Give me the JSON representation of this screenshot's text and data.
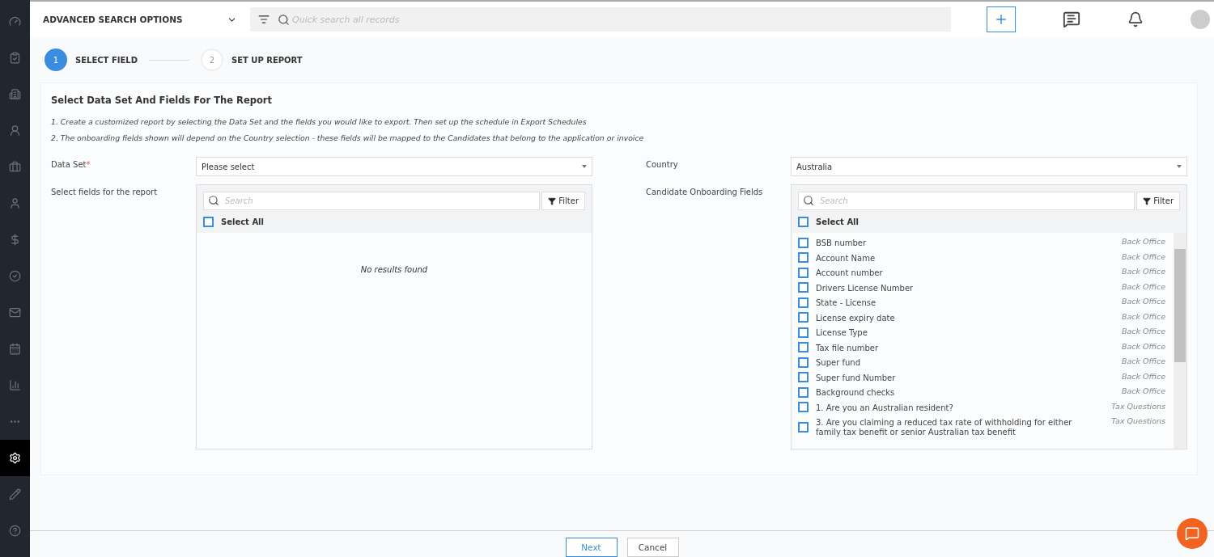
{
  "sidebar": {
    "items": [
      {
        "kind": "dashboard",
        "selected": false
      },
      {
        "kind": "tasks",
        "selected": false
      },
      {
        "kind": "building",
        "selected": false
      },
      {
        "kind": "contact",
        "selected": false
      },
      {
        "kind": "jobs",
        "selected": false
      },
      {
        "kind": "candidate",
        "selected": false
      },
      {
        "kind": "billing",
        "selected": false
      },
      {
        "kind": "approvals",
        "selected": false
      },
      {
        "kind": "mail",
        "selected": false
      },
      {
        "kind": "calendar",
        "selected": false
      },
      {
        "kind": "reports",
        "selected": false
      },
      {
        "kind": "more",
        "selected": false
      },
      {
        "kind": "settings",
        "selected": true
      },
      {
        "kind": "edit",
        "selected": false
      },
      {
        "kind": "help",
        "selected": false
      }
    ]
  },
  "topbar": {
    "search_options": "ADVANCED SEARCH OPTIONS",
    "search": {
      "placeholder": "Quick search all records"
    }
  },
  "steps": [
    {
      "number": "1",
      "label": "SELECT FIELD",
      "selected": true
    },
    {
      "number": "2",
      "label": "SET UP REPORT",
      "selected": false
    }
  ],
  "card": {
    "title": "Select Data Set And Fields For The Report",
    "notes": [
      "1. Create a customized report by selecting the Data Set and the fields you would like to export. Then set up the schedule in Export Schedules",
      "2. The onboarding fields shown will depend on the Country selection - these fields will be mapped to the Candidates that belong to the application or invoice"
    ],
    "left": {
      "select_label": "Data Set",
      "required_mark": "*",
      "select_value": "Please select",
      "list_label": "Select fields for the report",
      "search": {
        "placeholder": "Search"
      },
      "filter": "Filter",
      "select_all": {
        "label": "Select All",
        "checked": false
      },
      "empty": "No results found"
    },
    "right": {
      "select_label": "Country",
      "select_value": "Australia",
      "list_label": "Candidate Onboarding Fields",
      "search": {
        "placeholder": "Search"
      },
      "filter": "Filter",
      "select_all": {
        "label": "Select All",
        "checked": false
      },
      "fields": [
        {
          "label": "BSB number",
          "group": "Back Office",
          "checked": false
        },
        {
          "label": "Account Name",
          "group": "Back Office",
          "checked": false
        },
        {
          "label": "Account number",
          "group": "Back Office",
          "checked": false
        },
        {
          "label": "Drivers License Number",
          "group": "Back Office",
          "checked": false
        },
        {
          "label": "State - License",
          "group": "Back Office",
          "checked": false
        },
        {
          "label": "License expiry date",
          "group": "Back Office",
          "checked": false
        },
        {
          "label": "License Type",
          "group": "Back Office",
          "checked": false
        },
        {
          "label": "Tax file number",
          "group": "Back Office",
          "checked": false
        },
        {
          "label": "Super fund",
          "group": "Back Office",
          "checked": false
        },
        {
          "label": "Super fund Number",
          "group": "Back Office",
          "checked": false
        },
        {
          "label": "Background checks",
          "group": "Back Office",
          "checked": false
        },
        {
          "label": "1. Are you an Australian resident?",
          "group": "Tax Questions",
          "checked": false
        },
        {
          "label": "3. Are you claiming a reduced tax rate of withholding for either family tax benefit or senior Australian tax benefit",
          "group": "Tax Questions",
          "checked": false
        }
      ]
    }
  },
  "footer": {
    "buttons": [
      {
        "label": "Next",
        "kind": "primary"
      },
      {
        "label": "Cancel",
        "kind": "secondary"
      }
    ]
  }
}
